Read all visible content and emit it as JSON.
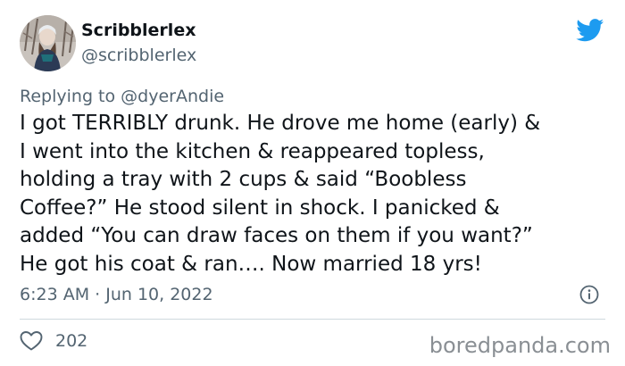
{
  "tweet": {
    "author": {
      "display_name": "Scribblerlex",
      "handle": "@scribblerlex",
      "avatar_icon": "profile-photo"
    },
    "brand_icon": "twitter-bird-icon",
    "brand_color": "#1d9bf0",
    "reply": {
      "prefix": "Replying to",
      "mention": "@dyerAndie"
    },
    "text_lines": [
      "I got TERRIBLY drunk. He drove me home (early) &",
      "I went into the kitchen & reappeared topless,",
      "holding a tray with 2 cups & said “Boobless",
      "Coffee?” He stood silent in shock. I panicked &",
      "added “You can draw faces on them if you want?”",
      "He got his coat & ran…. Now married 18 yrs!"
    ],
    "timestamp": "6:23 AM · Jun 10, 2022",
    "info_icon": "info-icon",
    "likes": {
      "icon": "heart-icon",
      "count": "202"
    }
  },
  "watermark": "boredpanda.com"
}
